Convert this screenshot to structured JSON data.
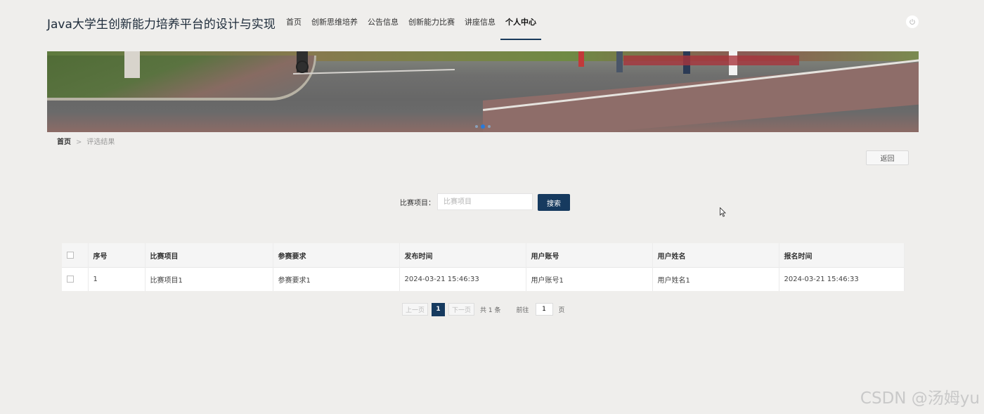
{
  "header": {
    "site_title": "Java大学生创新能力培养平台的设计与实现",
    "nav": [
      {
        "label": "首页"
      },
      {
        "label": "创新思维培养"
      },
      {
        "label": "公告信息"
      },
      {
        "label": "创新能力比赛"
      },
      {
        "label": "讲座信息"
      },
      {
        "label": "个人中心",
        "active": true
      }
    ],
    "power_icon": "power-icon"
  },
  "banner": {
    "slide_count": 3,
    "active_slide": 2
  },
  "breadcrumb": {
    "home": "首页",
    "separator": ">",
    "current": "评选结果"
  },
  "back_button": "返回",
  "search": {
    "label": "比赛项目：",
    "placeholder": "比赛项目",
    "value": "",
    "button": "搜索"
  },
  "table": {
    "columns": [
      "序号",
      "比赛项目",
      "参赛要求",
      "发布时间",
      "用户账号",
      "用户姓名",
      "报名时间"
    ],
    "rows": [
      [
        "1",
        "比赛项目1",
        "参赛要求1",
        "2024-03-21 15:46:33",
        "用户账号1",
        "用户姓名1",
        "2024-03-21 15:46:33"
      ]
    ]
  },
  "pagination": {
    "prev": "上一页",
    "current_page": "1",
    "next": "下一页",
    "total": "共 1 条",
    "goto_label": "前往",
    "goto_value": "1",
    "page_suffix": "页"
  },
  "watermark": "CSDN @汤姆yu"
}
